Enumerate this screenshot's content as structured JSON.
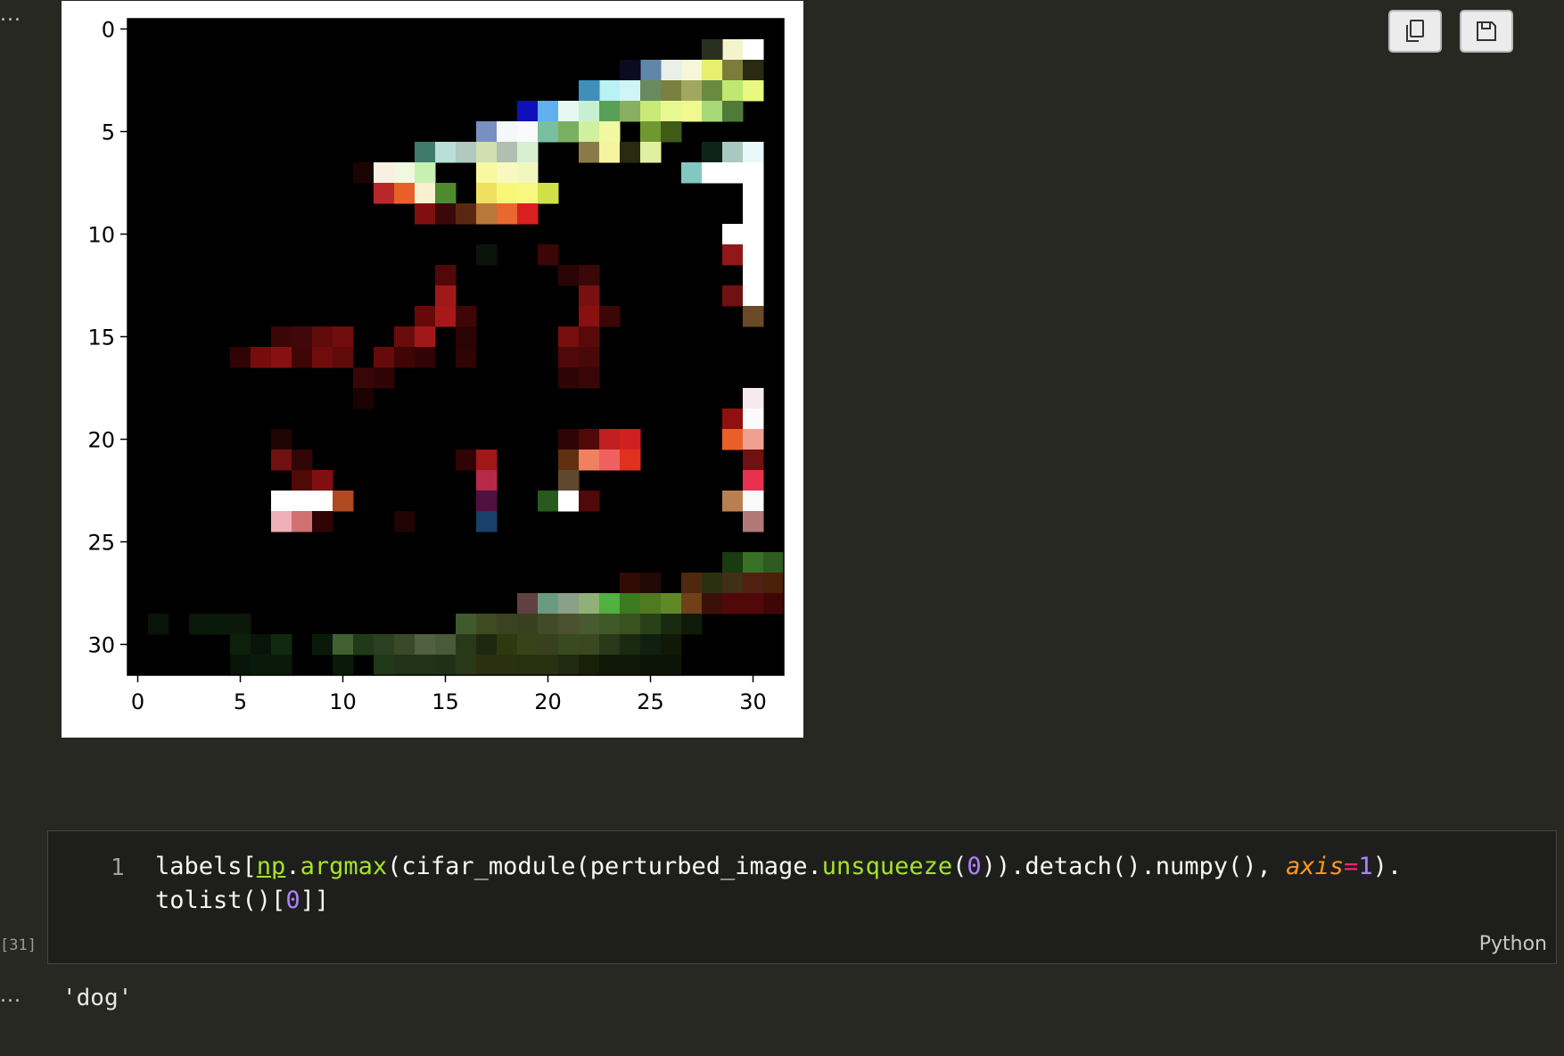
{
  "output_prompt_top": "...",
  "output_prompt_bottom": "...",
  "toolbar": {
    "copy_icon": "copy-icon",
    "save_icon": "save-icon"
  },
  "chart_data": {
    "type": "heatmap",
    "title": "",
    "xlabel": "",
    "ylabel": "",
    "image_size": [
      32,
      32
    ],
    "xticks": [
      "0",
      "5",
      "10",
      "15",
      "20",
      "25",
      "30"
    ],
    "yticks": [
      "0",
      "5",
      "10",
      "15",
      "20",
      "25",
      "30"
    ],
    "xlim": [
      -0.5,
      31.5
    ],
    "ylim": [
      31.5,
      -0.5
    ],
    "background_color": "#000000",
    "pixels": [
      {
        "x": 29,
        "y": 1,
        "c": "#f4f4cc"
      },
      {
        "x": 30,
        "y": 1,
        "c": "#ffffff"
      },
      {
        "x": 28,
        "y": 1,
        "c": "#2a3020"
      },
      {
        "x": 27,
        "y": 2,
        "c": "#f6f6d8"
      },
      {
        "x": 26,
        "y": 2,
        "c": "#e8f0e8"
      },
      {
        "x": 28,
        "y": 2,
        "c": "#e6f06e"
      },
      {
        "x": 29,
        "y": 2,
        "c": "#7d7d3a"
      },
      {
        "x": 30,
        "y": 2,
        "c": "#2a2a12"
      },
      {
        "x": 25,
        "y": 2,
        "c": "#5f87a8"
      },
      {
        "x": 24,
        "y": 2,
        "c": "#0a0a20"
      },
      {
        "x": 23,
        "y": 3,
        "c": "#b8f2f2"
      },
      {
        "x": 24,
        "y": 3,
        "c": "#cff5f5"
      },
      {
        "x": 22,
        "y": 3,
        "c": "#3f8fb8"
      },
      {
        "x": 25,
        "y": 3,
        "c": "#688a5e"
      },
      {
        "x": 26,
        "y": 3,
        "c": "#7a8040"
      },
      {
        "x": 27,
        "y": 3,
        "c": "#a0a860"
      },
      {
        "x": 28,
        "y": 3,
        "c": "#6a8a40"
      },
      {
        "x": 29,
        "y": 3,
        "c": "#c0e870"
      },
      {
        "x": 30,
        "y": 3,
        "c": "#e8f880"
      },
      {
        "x": 19,
        "y": 4,
        "c": "#1010b8"
      },
      {
        "x": 20,
        "y": 4,
        "c": "#60b0f0"
      },
      {
        "x": 21,
        "y": 4,
        "c": "#e6f8f0"
      },
      {
        "x": 22,
        "y": 4,
        "c": "#c6f0d0"
      },
      {
        "x": 23,
        "y": 4,
        "c": "#58a058"
      },
      {
        "x": 24,
        "y": 4,
        "c": "#88b060"
      },
      {
        "x": 25,
        "y": 4,
        "c": "#c8e878"
      },
      {
        "x": 26,
        "y": 4,
        "c": "#e8f890"
      },
      {
        "x": 27,
        "y": 4,
        "c": "#f0f890"
      },
      {
        "x": 28,
        "y": 4,
        "c": "#a8d878"
      },
      {
        "x": 29,
        "y": 4,
        "c": "#507a38"
      },
      {
        "x": 17,
        "y": 5,
        "c": "#7890c0"
      },
      {
        "x": 18,
        "y": 5,
        "c": "#f4f8f8"
      },
      {
        "x": 19,
        "y": 5,
        "c": "#fafafa"
      },
      {
        "x": 20,
        "y": 5,
        "c": "#78c0a0"
      },
      {
        "x": 21,
        "y": 5,
        "c": "#78b060"
      },
      {
        "x": 22,
        "y": 5,
        "c": "#d0f0a0"
      },
      {
        "x": 23,
        "y": 5,
        "c": "#f0f8a0"
      },
      {
        "x": 25,
        "y": 5,
        "c": "#709830"
      },
      {
        "x": 26,
        "y": 5,
        "c": "#405a18"
      },
      {
        "x": 14,
        "y": 6,
        "c": "#3f7a6a"
      },
      {
        "x": 15,
        "y": 6,
        "c": "#b8e0d8"
      },
      {
        "x": 16,
        "y": 6,
        "c": "#b0c8c0"
      },
      {
        "x": 17,
        "y": 6,
        "c": "#d0e0b0"
      },
      {
        "x": 18,
        "y": 6,
        "c": "#b0c0b0"
      },
      {
        "x": 19,
        "y": 6,
        "c": "#d8f0d0"
      },
      {
        "x": 22,
        "y": 6,
        "c": "#8a7a48"
      },
      {
        "x": 23,
        "y": 6,
        "c": "#f4f4a0"
      },
      {
        "x": 24,
        "y": 6,
        "c": "#2a2a10"
      },
      {
        "x": 25,
        "y": 6,
        "c": "#e0f0a0"
      },
      {
        "x": 28,
        "y": 6,
        "c": "#0e2418"
      },
      {
        "x": 29,
        "y": 6,
        "c": "#a8c8c0"
      },
      {
        "x": 30,
        "y": 6,
        "c": "#e8f8f8"
      },
      {
        "x": 11,
        "y": 7,
        "c": "#1a0404"
      },
      {
        "x": 12,
        "y": 7,
        "c": "#f8f0e0"
      },
      {
        "x": 13,
        "y": 7,
        "c": "#f0f8e0"
      },
      {
        "x": 14,
        "y": 7,
        "c": "#c8f0b0"
      },
      {
        "x": 17,
        "y": 7,
        "c": "#f8f8a0"
      },
      {
        "x": 18,
        "y": 7,
        "c": "#f8f8c0"
      },
      {
        "x": 19,
        "y": 7,
        "c": "#f0f8c0"
      },
      {
        "x": 27,
        "y": 7,
        "c": "#80c8c0"
      },
      {
        "x": 28,
        "y": 7,
        "c": "#ffffff"
      },
      {
        "x": 29,
        "y": 7,
        "c": "#ffffff"
      },
      {
        "x": 30,
        "y": 7,
        "c": "#ffffff"
      },
      {
        "x": 12,
        "y": 8,
        "c": "#b82828"
      },
      {
        "x": 13,
        "y": 8,
        "c": "#e86028"
      },
      {
        "x": 14,
        "y": 8,
        "c": "#f8f0d0"
      },
      {
        "x": 15,
        "y": 8,
        "c": "#508a30"
      },
      {
        "x": 17,
        "y": 8,
        "c": "#f0e060"
      },
      {
        "x": 18,
        "y": 8,
        "c": "#f8f878"
      },
      {
        "x": 19,
        "y": 8,
        "c": "#f8f880"
      },
      {
        "x": 20,
        "y": 8,
        "c": "#d0e048"
      },
      {
        "x": 30,
        "y": 8,
        "c": "#ffffff"
      },
      {
        "x": 14,
        "y": 9,
        "c": "#801010"
      },
      {
        "x": 15,
        "y": 9,
        "c": "#3a0808"
      },
      {
        "x": 16,
        "y": 9,
        "c": "#5a2810"
      },
      {
        "x": 17,
        "y": 9,
        "c": "#b87838"
      },
      {
        "x": 18,
        "y": 9,
        "c": "#e86830"
      },
      {
        "x": 19,
        "y": 9,
        "c": "#d82020"
      },
      {
        "x": 30,
        "y": 9,
        "c": "#ffffff"
      },
      {
        "x": 29,
        "y": 10,
        "c": "#ffffff"
      },
      {
        "x": 30,
        "y": 10,
        "c": "#ffffff"
      },
      {
        "x": 17,
        "y": 11,
        "c": "#0a140a"
      },
      {
        "x": 20,
        "y": 11,
        "c": "#3a0606"
      },
      {
        "x": 29,
        "y": 11,
        "c": "#901818"
      },
      {
        "x": 30,
        "y": 11,
        "c": "#ffffff"
      },
      {
        "x": 15,
        "y": 12,
        "c": "#500808"
      },
      {
        "x": 21,
        "y": 12,
        "c": "#2a0404"
      },
      {
        "x": 22,
        "y": 12,
        "c": "#3a0808"
      },
      {
        "x": 30,
        "y": 12,
        "c": "#ffffff"
      },
      {
        "x": 15,
        "y": 13,
        "c": "#a01818"
      },
      {
        "x": 22,
        "y": 13,
        "c": "#781010"
      },
      {
        "x": 29,
        "y": 13,
        "c": "#701010"
      },
      {
        "x": 30,
        "y": 13,
        "c": "#ffffff"
      },
      {
        "x": 14,
        "y": 14,
        "c": "#680808"
      },
      {
        "x": 15,
        "y": 14,
        "c": "#a81818"
      },
      {
        "x": 16,
        "y": 14,
        "c": "#400606"
      },
      {
        "x": 22,
        "y": 14,
        "c": "#881010"
      },
      {
        "x": 23,
        "y": 14,
        "c": "#3a0606"
      },
      {
        "x": 30,
        "y": 14,
        "c": "#6a4a28"
      },
      {
        "x": 7,
        "y": 15,
        "c": "#3a0606"
      },
      {
        "x": 8,
        "y": 15,
        "c": "#400808"
      },
      {
        "x": 9,
        "y": 15,
        "c": "#600a0a"
      },
      {
        "x": 10,
        "y": 15,
        "c": "#700c0c"
      },
      {
        "x": 13,
        "y": 15,
        "c": "#6a0c0c"
      },
      {
        "x": 14,
        "y": 15,
        "c": "#a01818"
      },
      {
        "x": 16,
        "y": 15,
        "c": "#2a0404"
      },
      {
        "x": 21,
        "y": 15,
        "c": "#780e0e"
      },
      {
        "x": 22,
        "y": 15,
        "c": "#580a0a"
      },
      {
        "x": 5,
        "y": 16,
        "c": "#300404"
      },
      {
        "x": 6,
        "y": 16,
        "c": "#780c0c"
      },
      {
        "x": 7,
        "y": 16,
        "c": "#881010"
      },
      {
        "x": 8,
        "y": 16,
        "c": "#400606"
      },
      {
        "x": 9,
        "y": 16,
        "c": "#700c0c"
      },
      {
        "x": 10,
        "y": 16,
        "c": "#600a0a"
      },
      {
        "x": 12,
        "y": 16,
        "c": "#680a0a"
      },
      {
        "x": 13,
        "y": 16,
        "c": "#400606"
      },
      {
        "x": 14,
        "y": 16,
        "c": "#300404"
      },
      {
        "x": 16,
        "y": 16,
        "c": "#300404"
      },
      {
        "x": 21,
        "y": 16,
        "c": "#500808"
      },
      {
        "x": 22,
        "y": 16,
        "c": "#480808"
      },
      {
        "x": 11,
        "y": 17,
        "c": "#380606"
      },
      {
        "x": 12,
        "y": 17,
        "c": "#300404"
      },
      {
        "x": 21,
        "y": 17,
        "c": "#300404"
      },
      {
        "x": 22,
        "y": 17,
        "c": "#380606"
      },
      {
        "x": 11,
        "y": 18,
        "c": "#1a0202"
      },
      {
        "x": 30,
        "y": 18,
        "c": "#f8e8f0"
      },
      {
        "x": 29,
        "y": 19,
        "c": "#901010"
      },
      {
        "x": 30,
        "y": 19,
        "c": "#fafafa"
      },
      {
        "x": 7,
        "y": 20,
        "c": "#200404"
      },
      {
        "x": 21,
        "y": 20,
        "c": "#300404"
      },
      {
        "x": 22,
        "y": 20,
        "c": "#500808"
      },
      {
        "x": 23,
        "y": 20,
        "c": "#c02020"
      },
      {
        "x": 24,
        "y": 20,
        "c": "#d02020"
      },
      {
        "x": 29,
        "y": 20,
        "c": "#e86028"
      },
      {
        "x": 30,
        "y": 20,
        "c": "#f0a090"
      },
      {
        "x": 7,
        "y": 21,
        "c": "#701010"
      },
      {
        "x": 8,
        "y": 21,
        "c": "#300606"
      },
      {
        "x": 16,
        "y": 21,
        "c": "#300404"
      },
      {
        "x": 17,
        "y": 21,
        "c": "#a01818"
      },
      {
        "x": 21,
        "y": 21,
        "c": "#603010"
      },
      {
        "x": 22,
        "y": 21,
        "c": "#f08060"
      },
      {
        "x": 23,
        "y": 21,
        "c": "#f06060"
      },
      {
        "x": 24,
        "y": 21,
        "c": "#e03020"
      },
      {
        "x": 30,
        "y": 21,
        "c": "#701010"
      },
      {
        "x": 8,
        "y": 22,
        "c": "#500808"
      },
      {
        "x": 9,
        "y": 22,
        "c": "#801010"
      },
      {
        "x": 17,
        "y": 22,
        "c": "#b82848"
      },
      {
        "x": 21,
        "y": 22,
        "c": "#604830"
      },
      {
        "x": 30,
        "y": 22,
        "c": "#e83050"
      },
      {
        "x": 7,
        "y": 23,
        "c": "#ffffff"
      },
      {
        "x": 8,
        "y": 23,
        "c": "#ffffff"
      },
      {
        "x": 9,
        "y": 23,
        "c": "#ffffff"
      },
      {
        "x": 10,
        "y": 23,
        "c": "#b04820"
      },
      {
        "x": 17,
        "y": 23,
        "c": "#501040"
      },
      {
        "x": 20,
        "y": 23,
        "c": "#285a20"
      },
      {
        "x": 21,
        "y": 23,
        "c": "#ffffff"
      },
      {
        "x": 22,
        "y": 23,
        "c": "#500808"
      },
      {
        "x": 29,
        "y": 23,
        "c": "#b88050"
      },
      {
        "x": 30,
        "y": 23,
        "c": "#fafafa"
      },
      {
        "x": 7,
        "y": 24,
        "c": "#f0b0b8"
      },
      {
        "x": 8,
        "y": 24,
        "c": "#d07070"
      },
      {
        "x": 9,
        "y": 24,
        "c": "#300404"
      },
      {
        "x": 13,
        "y": 24,
        "c": "#200404"
      },
      {
        "x": 17,
        "y": 24,
        "c": "#184068"
      },
      {
        "x": 30,
        "y": 24,
        "c": "#b07878"
      },
      {
        "x": 29,
        "y": 26,
        "c": "#1a3a10"
      },
      {
        "x": 30,
        "y": 26,
        "c": "#387028"
      },
      {
        "x": 31,
        "y": 26,
        "c": "#2f5a20"
      },
      {
        "x": 24,
        "y": 27,
        "c": "#300c04"
      },
      {
        "x": 25,
        "y": 27,
        "c": "#200804"
      },
      {
        "x": 27,
        "y": 27,
        "c": "#502810"
      },
      {
        "x": 28,
        "y": 27,
        "c": "#2a3010"
      },
      {
        "x": 29,
        "y": 27,
        "c": "#403018"
      },
      {
        "x": 30,
        "y": 27,
        "c": "#502010"
      },
      {
        "x": 31,
        "y": 27,
        "c": "#4a2008"
      },
      {
        "x": 19,
        "y": 28,
        "c": "#604040"
      },
      {
        "x": 20,
        "y": 28,
        "c": "#6a9a80"
      },
      {
        "x": 21,
        "y": 28,
        "c": "#8aa088"
      },
      {
        "x": 22,
        "y": 28,
        "c": "#90b078"
      },
      {
        "x": 23,
        "y": 28,
        "c": "#50b040"
      },
      {
        "x": 24,
        "y": 28,
        "c": "#3a7a20"
      },
      {
        "x": 25,
        "y": 28,
        "c": "#507a20"
      },
      {
        "x": 26,
        "y": 28,
        "c": "#608828"
      },
      {
        "x": 27,
        "y": 28,
        "c": "#704018"
      },
      {
        "x": 28,
        "y": 28,
        "c": "#3a1008"
      },
      {
        "x": 29,
        "y": 28,
        "c": "#500808"
      },
      {
        "x": 30,
        "y": 28,
        "c": "#500808"
      },
      {
        "x": 31,
        "y": 28,
        "c": "#400606"
      },
      {
        "x": 1,
        "y": 29,
        "c": "#081408"
      },
      {
        "x": 3,
        "y": 29,
        "c": "#0a180a"
      },
      {
        "x": 4,
        "y": 29,
        "c": "#0a1a0a"
      },
      {
        "x": 5,
        "y": 29,
        "c": "#0c180a"
      },
      {
        "x": 16,
        "y": 29,
        "c": "#405a30"
      },
      {
        "x": 17,
        "y": 29,
        "c": "#404a20"
      },
      {
        "x": 18,
        "y": 29,
        "c": "#3a4220"
      },
      {
        "x": 19,
        "y": 29,
        "c": "#384020"
      },
      {
        "x": 20,
        "y": 29,
        "c": "#424a28"
      },
      {
        "x": 21,
        "y": 29,
        "c": "#4a5030"
      },
      {
        "x": 22,
        "y": 29,
        "c": "#485a30"
      },
      {
        "x": 23,
        "y": 29,
        "c": "#405828"
      },
      {
        "x": 24,
        "y": 29,
        "c": "#3a5220"
      },
      {
        "x": 25,
        "y": 29,
        "c": "#2a4018"
      },
      {
        "x": 26,
        "y": 29,
        "c": "#1a2a10"
      },
      {
        "x": 27,
        "y": 29,
        "c": "#101a08"
      },
      {
        "x": 5,
        "y": 30,
        "c": "#0c200c"
      },
      {
        "x": 6,
        "y": 30,
        "c": "#081408"
      },
      {
        "x": 7,
        "y": 30,
        "c": "#102810"
      },
      {
        "x": 9,
        "y": 30,
        "c": "#0a1a0a"
      },
      {
        "x": 10,
        "y": 30,
        "c": "#406030"
      },
      {
        "x": 11,
        "y": 30,
        "c": "#203a18"
      },
      {
        "x": 12,
        "y": 30,
        "c": "#2a4020"
      },
      {
        "x": 13,
        "y": 30,
        "c": "#3a4a28"
      },
      {
        "x": 14,
        "y": 30,
        "c": "#506040"
      },
      {
        "x": 15,
        "y": 30,
        "c": "#485a38"
      },
      {
        "x": 16,
        "y": 30,
        "c": "#283818"
      },
      {
        "x": 17,
        "y": 30,
        "c": "#1e2810"
      },
      {
        "x": 18,
        "y": 30,
        "c": "#303810"
      },
      {
        "x": 19,
        "y": 30,
        "c": "#3a4218"
      },
      {
        "x": 20,
        "y": 30,
        "c": "#384020"
      },
      {
        "x": 21,
        "y": 30,
        "c": "#3a4a20"
      },
      {
        "x": 22,
        "y": 30,
        "c": "#3a4820"
      },
      {
        "x": 23,
        "y": 30,
        "c": "#283818"
      },
      {
        "x": 24,
        "y": 30,
        "c": "#1a2a10"
      },
      {
        "x": 25,
        "y": 30,
        "c": "#102010"
      },
      {
        "x": 26,
        "y": 30,
        "c": "#101808"
      },
      {
        "x": 5,
        "y": 31,
        "c": "#081408"
      },
      {
        "x": 6,
        "y": 31,
        "c": "#0a1a0a"
      },
      {
        "x": 7,
        "y": 31,
        "c": "#0a1a0a"
      },
      {
        "x": 10,
        "y": 31,
        "c": "#0a1a0a"
      },
      {
        "x": 12,
        "y": 31,
        "c": "#203818"
      },
      {
        "x": 13,
        "y": 31,
        "c": "#203218"
      },
      {
        "x": 14,
        "y": 31,
        "c": "#203218"
      },
      {
        "x": 15,
        "y": 31,
        "c": "#203018"
      },
      {
        "x": 16,
        "y": 31,
        "c": "#283818"
      },
      {
        "x": 17,
        "y": 31,
        "c": "#2a3010"
      },
      {
        "x": 18,
        "y": 31,
        "c": "#2a3010"
      },
      {
        "x": 19,
        "y": 31,
        "c": "#283010"
      },
      {
        "x": 20,
        "y": 31,
        "c": "#283010"
      },
      {
        "x": 21,
        "y": 31,
        "c": "#202a10"
      },
      {
        "x": 22,
        "y": 31,
        "c": "#182008"
      },
      {
        "x": 23,
        "y": 31,
        "c": "#101808"
      },
      {
        "x": 24,
        "y": 31,
        "c": "#101808"
      },
      {
        "x": 25,
        "y": 31,
        "c": "#0c1408"
      },
      {
        "x": 26,
        "y": 31,
        "c": "#0c1408"
      }
    ]
  },
  "cell": {
    "line_number": "1",
    "execution_count": "[31]",
    "language": "Python",
    "code_line1": [
      {
        "t": "labels[",
        "cls": ""
      },
      {
        "t": "np",
        "cls": "tok-green tok-under"
      },
      {
        "t": ".",
        "cls": ""
      },
      {
        "t": "argmax",
        "cls": "tok-green"
      },
      {
        "t": "(cifar_module(perturbed_image.",
        "cls": ""
      },
      {
        "t": "unsqueeze",
        "cls": "tok-green"
      },
      {
        "t": "(",
        "cls": ""
      },
      {
        "t": "0",
        "cls": "tok-num"
      },
      {
        "t": ")).detach().numpy(), ",
        "cls": ""
      },
      {
        "t": "axis",
        "cls": "tok-param"
      },
      {
        "t": "=",
        "cls": "tok-eq"
      },
      {
        "t": "1",
        "cls": "tok-num"
      },
      {
        "t": ").",
        "cls": ""
      }
    ],
    "code_line2": [
      {
        "t": "tolist()[",
        "cls": ""
      },
      {
        "t": "0",
        "cls": "tok-num"
      },
      {
        "t": "]]",
        "cls": ""
      }
    ]
  },
  "output": {
    "text": "'dog'"
  }
}
